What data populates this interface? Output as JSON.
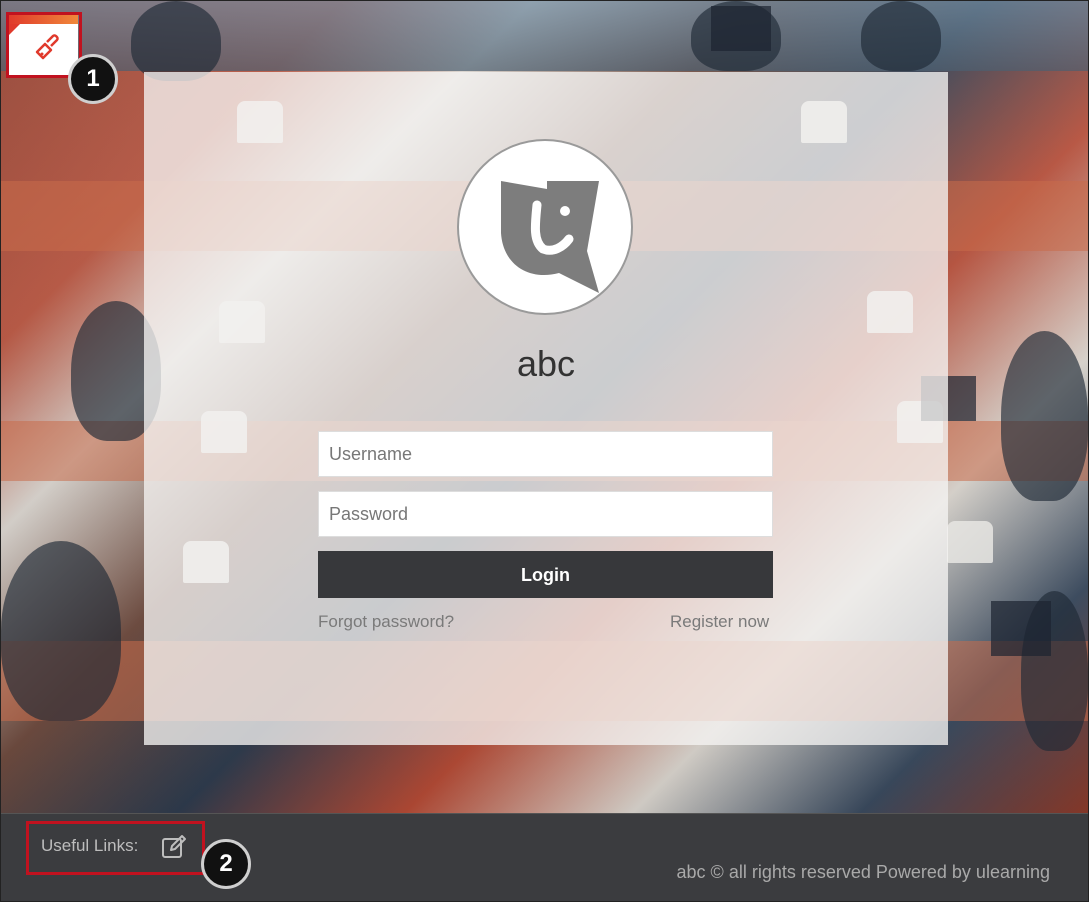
{
  "site": {
    "name": "abc"
  },
  "login_form": {
    "username_placeholder": "Username",
    "password_placeholder": "Password",
    "login_label": "Login",
    "forgot_password_label": "Forgot password?",
    "register_label": "Register now"
  },
  "footer": {
    "useful_links_label": "Useful Links:",
    "copyright_text": "abc © all rights reserved  Powered by ulearning"
  },
  "annotations": {
    "callout_1": "1",
    "callout_2": "2"
  },
  "icons": {
    "theme": "paint-brush-icon",
    "edit": "edit-icon",
    "logo": "ulearning-logo"
  },
  "colors": {
    "accent_red": "#c1121f",
    "button_dark": "#37383b",
    "footer_bg": "#3b3c3f"
  }
}
